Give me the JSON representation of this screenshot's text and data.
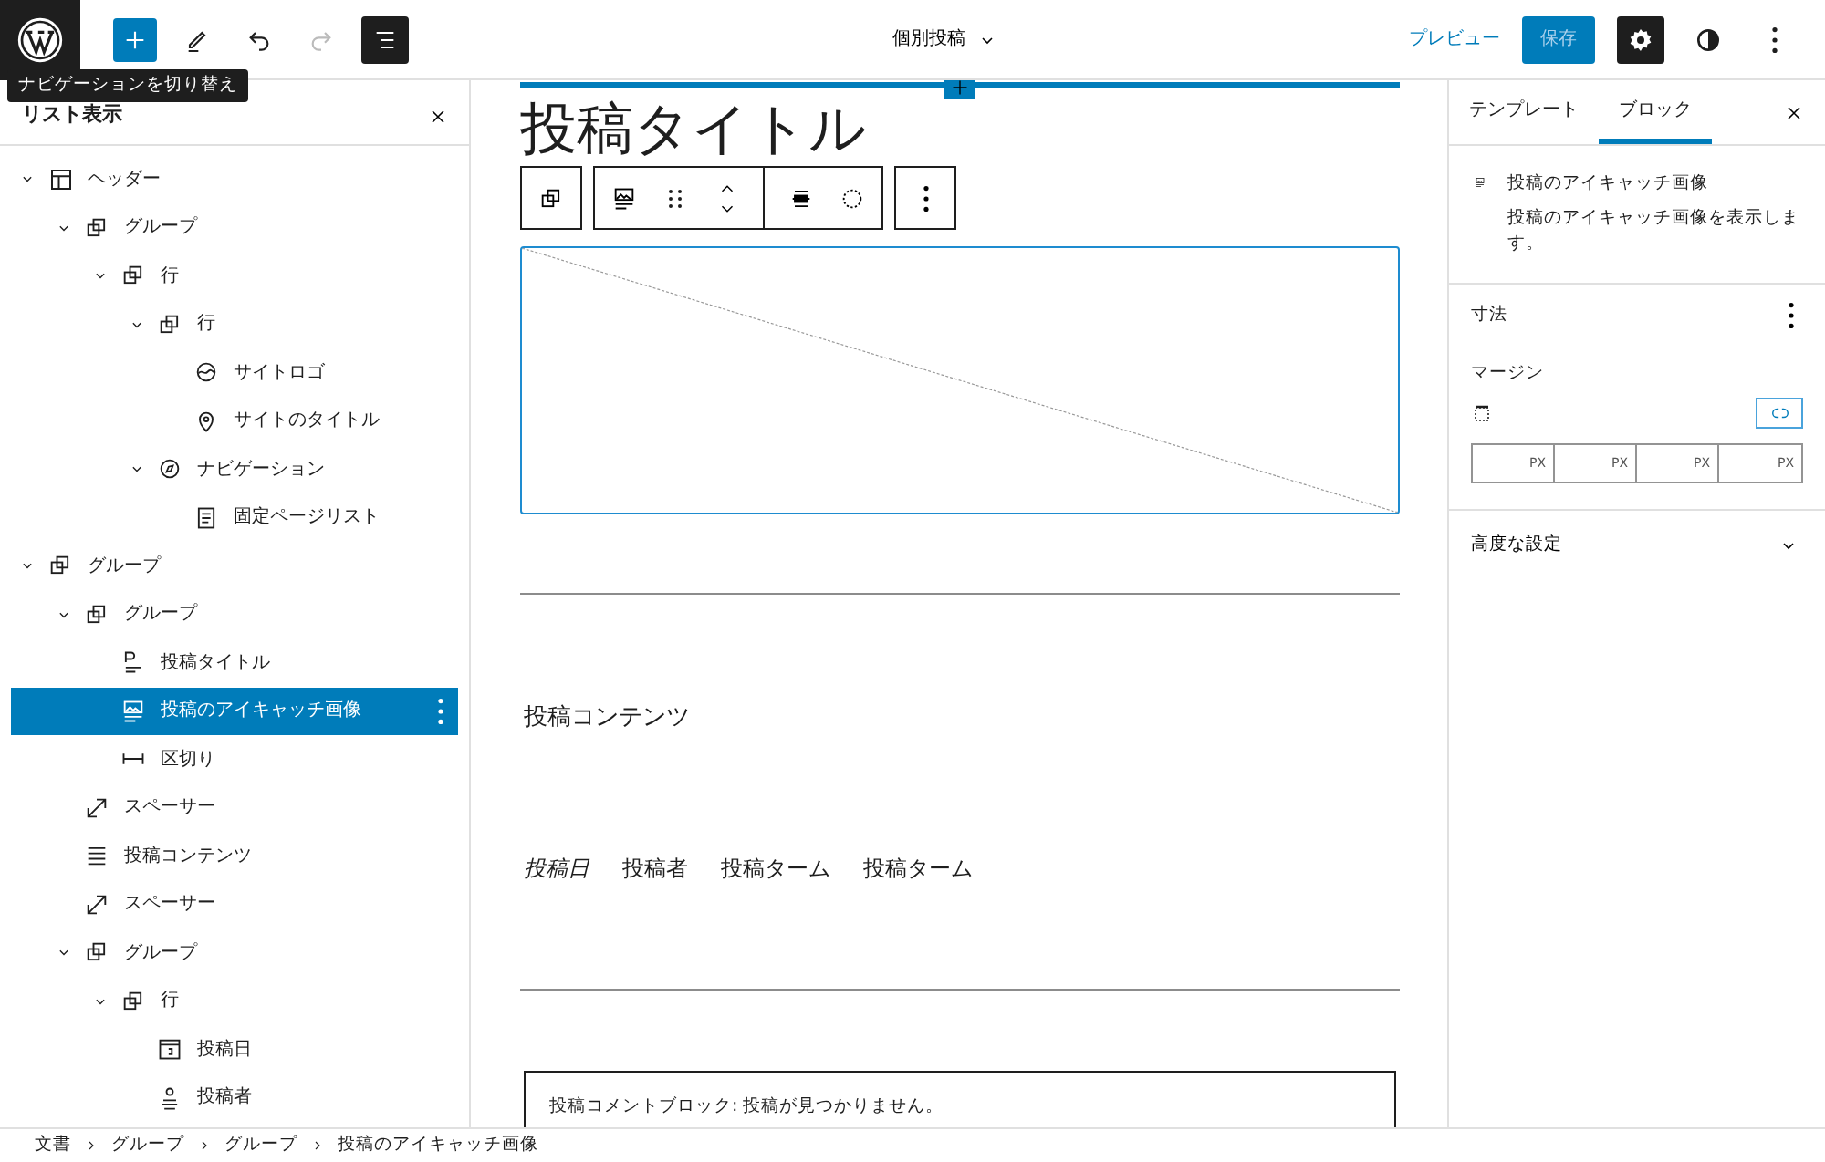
{
  "top_bar": {
    "tools": [
      {
        "kind": "add",
        "pressed": false,
        "disabled": false
      },
      {
        "kind": "edit",
        "pressed": false,
        "disabled": false
      },
      {
        "kind": "undo",
        "pressed": false,
        "disabled": false
      },
      {
        "kind": "redo",
        "pressed": false,
        "disabled": true
      },
      {
        "kind": "list_view",
        "pressed": true,
        "disabled": false
      }
    ],
    "document_title": "個別投稿",
    "preview": "プレビュー",
    "save": {
      "label": "保存",
      "disabled": true
    },
    "actions": [
      {
        "kind": "settings",
        "pressed": true
      },
      {
        "kind": "styles",
        "pressed": false
      },
      {
        "kind": "more",
        "pressed": false
      }
    ]
  },
  "tooltip": "ナビゲーションを切り替え",
  "list_view": {
    "title": "リスト表示",
    "items": [
      {
        "label": "ヘッダー",
        "kind": "template_part",
        "selected": false,
        "expanded": true,
        "children": [
          {
            "label": "グループ",
            "kind": "group",
            "selected": false,
            "expanded": true,
            "children": [
              {
                "label": "行",
                "kind": "group",
                "selected": false,
                "expanded": true,
                "children": [
                  {
                    "label": "行",
                    "kind": "group",
                    "selected": false,
                    "expanded": true,
                    "children": [
                      {
                        "label": "サイトロゴ",
                        "kind": "site_logo",
                        "selected": false
                      },
                      {
                        "label": "サイトのタイトル",
                        "kind": "site_title",
                        "selected": false
                      }
                    ]
                  },
                  {
                    "label": "ナビゲーション",
                    "kind": "navigation",
                    "selected": false,
                    "expanded": true,
                    "children": [
                      {
                        "label": "固定ページリスト",
                        "kind": "page_list",
                        "selected": false
                      }
                    ]
                  }
                ]
              }
            ]
          }
        ]
      },
      {
        "label": "グループ",
        "kind": "group",
        "selected": false,
        "expanded": true,
        "children": [
          {
            "label": "グループ",
            "kind": "group",
            "selected": false,
            "expanded": true,
            "children": [
              {
                "label": "投稿タイトル",
                "kind": "post_title",
                "selected": false
              },
              {
                "label": "投稿のアイキャッチ画像",
                "kind": "featured_image",
                "selected": true
              },
              {
                "label": "区切り",
                "kind": "separator",
                "selected": false
              }
            ]
          },
          {
            "label": "スペーサー",
            "kind": "spacer",
            "selected": false
          },
          {
            "label": "投稿コンテンツ",
            "kind": "post_content",
            "selected": false
          },
          {
            "label": "スペーサー",
            "kind": "spacer",
            "selected": false
          },
          {
            "label": "グループ",
            "kind": "group",
            "selected": false,
            "expanded": true,
            "children": [
              {
                "label": "行",
                "kind": "group",
                "selected": false,
                "expanded": true,
                "children": [
                  {
                    "label": "投稿日",
                    "kind": "post_date",
                    "selected": false
                  },
                  {
                    "label": "投稿者",
                    "kind": "post_author",
                    "selected": false
                  }
                ]
              }
            ]
          }
        ]
      }
    ]
  },
  "canvas": {
    "post_title": "投稿タイトル",
    "content": "投稿コンテンツ",
    "meta": [
      {
        "text": "投稿日",
        "kind": "date"
      },
      {
        "text": "投稿者",
        "kind": "author"
      },
      {
        "text": "投稿ターム",
        "kind": "terms"
      },
      {
        "text": "投稿ターム",
        "kind": "terms"
      }
    ],
    "comments": "投稿コメントブロック: 投稿が見つかりません。"
  },
  "settings_sidebar": {
    "tabs": [
      {
        "label": "テンプレート",
        "selected": false
      },
      {
        "label": "ブロック",
        "selected": true
      }
    ],
    "block": {
      "title": "投稿のアイキャッチ画像",
      "description": "投稿のアイキャッチ画像を表示します。"
    },
    "dimensions": {
      "title": "寸法",
      "margin_label": "マージン",
      "linked": true,
      "inputs": [
        {
          "unit": "PX"
        },
        {
          "unit": "PX"
        },
        {
          "unit": "PX"
        },
        {
          "unit": "PX"
        }
      ]
    },
    "advanced": {
      "title": "高度な設定",
      "expanded": false
    }
  },
  "breadcrumb": [
    "文書",
    "グループ",
    "グループ",
    "投稿のアイキャッチ画像"
  ]
}
